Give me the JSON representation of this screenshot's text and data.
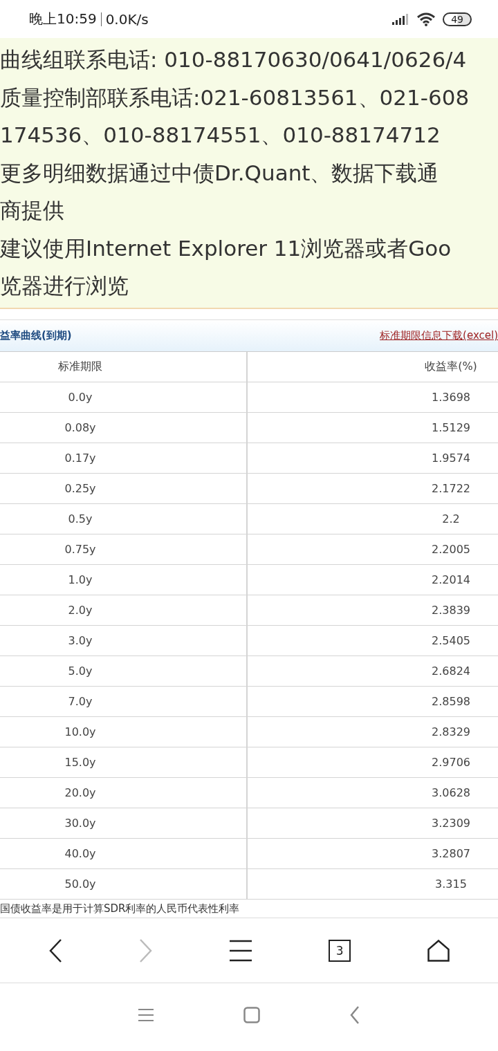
{
  "status_bar": {
    "time": "晚上10:59",
    "speed": "0.0K/s",
    "battery": "49"
  },
  "notice": {
    "lines": [
      "曲线组联系电话: 010-88170630/0641/0626/4",
      "质量控制部联系电话:021-60813561、021-608",
      "174536、010-88174551、010-88174712",
      "更多明细数据通过中债Dr.Quant、数据下载通",
      "商提供",
      "建议使用Internet Explorer 11浏览器或者Goo",
      "览器进行浏览"
    ]
  },
  "table": {
    "title": "益率曲线(到期)",
    "download_link": "标准期限信息下载(excel)",
    "columns": [
      "标准期限",
      "收益率(%)"
    ],
    "rows": [
      [
        "0.0y",
        "1.3698"
      ],
      [
        "0.08y",
        "1.5129"
      ],
      [
        "0.17y",
        "1.9574"
      ],
      [
        "0.25y",
        "2.1722"
      ],
      [
        "0.5y",
        "2.2"
      ],
      [
        "0.75y",
        "2.2005"
      ],
      [
        "1.0y",
        "2.2014"
      ],
      [
        "2.0y",
        "2.3839"
      ],
      [
        "3.0y",
        "2.5405"
      ],
      [
        "5.0y",
        "2.6824"
      ],
      [
        "7.0y",
        "2.8598"
      ],
      [
        "10.0y",
        "2.8329"
      ],
      [
        "15.0y",
        "2.9706"
      ],
      [
        "20.0y",
        "3.0628"
      ],
      [
        "30.0y",
        "3.2309"
      ],
      [
        "40.0y",
        "3.2807"
      ],
      [
        "50.0y",
        "3.315"
      ]
    ]
  },
  "footnote": "国债收益率是用于计算SDR利率的人民币代表性利率",
  "browser_toolbar": [
    {
      "kind": "back",
      "disabled": false
    },
    {
      "kind": "forward",
      "disabled": true
    },
    {
      "kind": "menu",
      "disabled": false
    },
    {
      "kind": "tabs",
      "label": "3",
      "disabled": false
    },
    {
      "kind": "home",
      "disabled": false
    }
  ],
  "nav_bar": [
    {
      "kind": "menu"
    },
    {
      "kind": "home"
    },
    {
      "kind": "back"
    }
  ]
}
